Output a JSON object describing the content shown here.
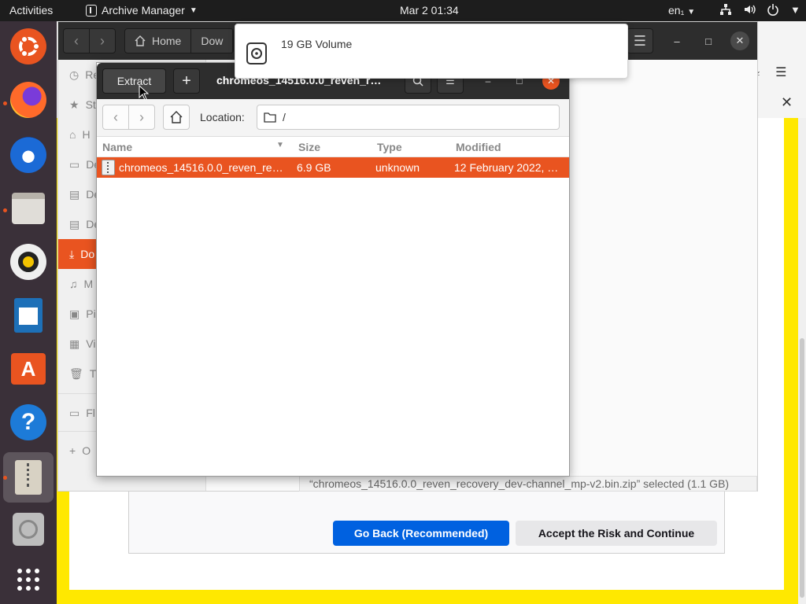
{
  "topbar": {
    "activities": "Activities",
    "app_name": "Archive Manager",
    "clock": "Mar 2  01:34",
    "language": "en₁"
  },
  "dock": {
    "items": [
      "ubuntu-logo-icon",
      "firefox-icon",
      "thunderbird-icon",
      "files-icon",
      "rhythmbox-icon",
      "libreoffice-writer-icon",
      "software-icon",
      "help-icon",
      "archive-manager-icon",
      "disk-icon",
      "app-grid-icon"
    ]
  },
  "browser": {
    "go_back_label": "Go Back (Recommended)",
    "accept_label": "Accept the Risk and Continue",
    "accent": "#0061e0",
    "warning_color": "#ffe800"
  },
  "files": {
    "path_home": "Home",
    "path_current": "Dow",
    "sidebar": [
      "Re",
      "St",
      "H",
      "De",
      "Do",
      "De",
      "M",
      "Pi",
      "Vi",
      "Tr",
      "Fl",
      "O"
    ],
    "status": "“chromeos_14516.0.0_reven_recovery_dev-channel_mp-v2.bin.zip” selected  (1.1 GB)"
  },
  "archive": {
    "extract_label": "Extract",
    "title": "chromeos_14516.0.0_reven_r…",
    "location_label": "Location:",
    "location_value": "/",
    "columns": {
      "name": "Name",
      "size": "Size",
      "type": "Type",
      "modified": "Modified"
    },
    "rows": [
      {
        "name": "chromeos_14516.0.0_reven_re…",
        "size": "6.9 GB",
        "type": "unknown",
        "modified": "12 February 2022, …"
      }
    ],
    "accent": "#e95420"
  },
  "notification": {
    "title": "19 GB Volume"
  }
}
